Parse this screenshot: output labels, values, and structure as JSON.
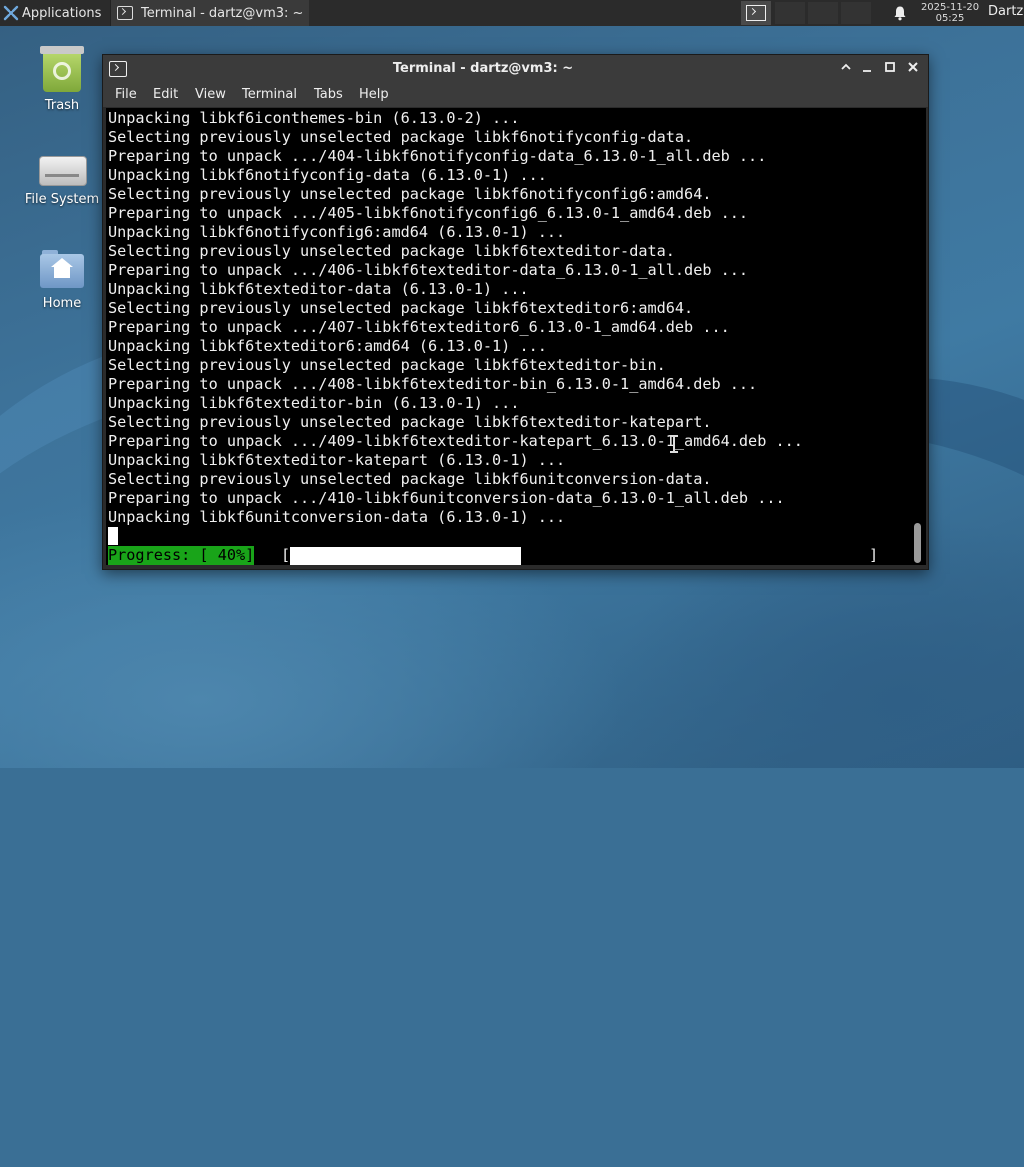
{
  "panel": {
    "applications_label": "Applications",
    "task_title": "Terminal - dartz@vm3: ~",
    "clock_date": "2025-11-20",
    "clock_time": "05:25",
    "user_name": "Dartz"
  },
  "desktop_icons": {
    "trash": "Trash",
    "filesystem": "File System",
    "home": "Home"
  },
  "window": {
    "title": "Terminal - dartz@vm3: ~",
    "menu": [
      "File",
      "Edit",
      "View",
      "Terminal",
      "Tabs",
      "Help"
    ]
  },
  "terminal": {
    "lines": [
      "Unpacking libkf6iconthemes-bin (6.13.0-2) ...",
      "Selecting previously unselected package libkf6notifyconfig-data.",
      "Preparing to unpack .../404-libkf6notifyconfig-data_6.13.0-1_all.deb ...",
      "Unpacking libkf6notifyconfig-data (6.13.0-1) ...",
      "Selecting previously unselected package libkf6notifyconfig6:amd64.",
      "Preparing to unpack .../405-libkf6notifyconfig6_6.13.0-1_amd64.deb ...",
      "Unpacking libkf6notifyconfig6:amd64 (6.13.0-1) ...",
      "Selecting previously unselected package libkf6texteditor-data.",
      "Preparing to unpack .../406-libkf6texteditor-data_6.13.0-1_all.deb ...",
      "Unpacking libkf6texteditor-data (6.13.0-1) ...",
      "Selecting previously unselected package libkf6texteditor6:amd64.",
      "Preparing to unpack .../407-libkf6texteditor6_6.13.0-1_amd64.deb ...",
      "Unpacking libkf6texteditor6:amd64 (6.13.0-1) ...",
      "Selecting previously unselected package libkf6texteditor-bin.",
      "Preparing to unpack .../408-libkf6texteditor-bin_6.13.0-1_amd64.deb ...",
      "Unpacking libkf6texteditor-bin (6.13.0-1) ...",
      "Selecting previously unselected package libkf6texteditor-katepart.",
      "Preparing to unpack .../409-libkf6texteditor-katepart_6.13.0-1_amd64.deb ...",
      "Unpacking libkf6texteditor-katepart (6.13.0-1) ...",
      "Selecting previously unselected package libkf6unitconversion-data.",
      "Preparing to unpack .../410-libkf6unitconversion-data_6.13.0-1_all.deb ...",
      "Unpacking libkf6unitconversion-data (6.13.0-1) ..."
    ],
    "progress_label": "Progress: [ 40%]",
    "progress_fraction": 0.4,
    "bracket_open": "[",
    "bracket_close": "]",
    "progress_color": "#19a419"
  }
}
